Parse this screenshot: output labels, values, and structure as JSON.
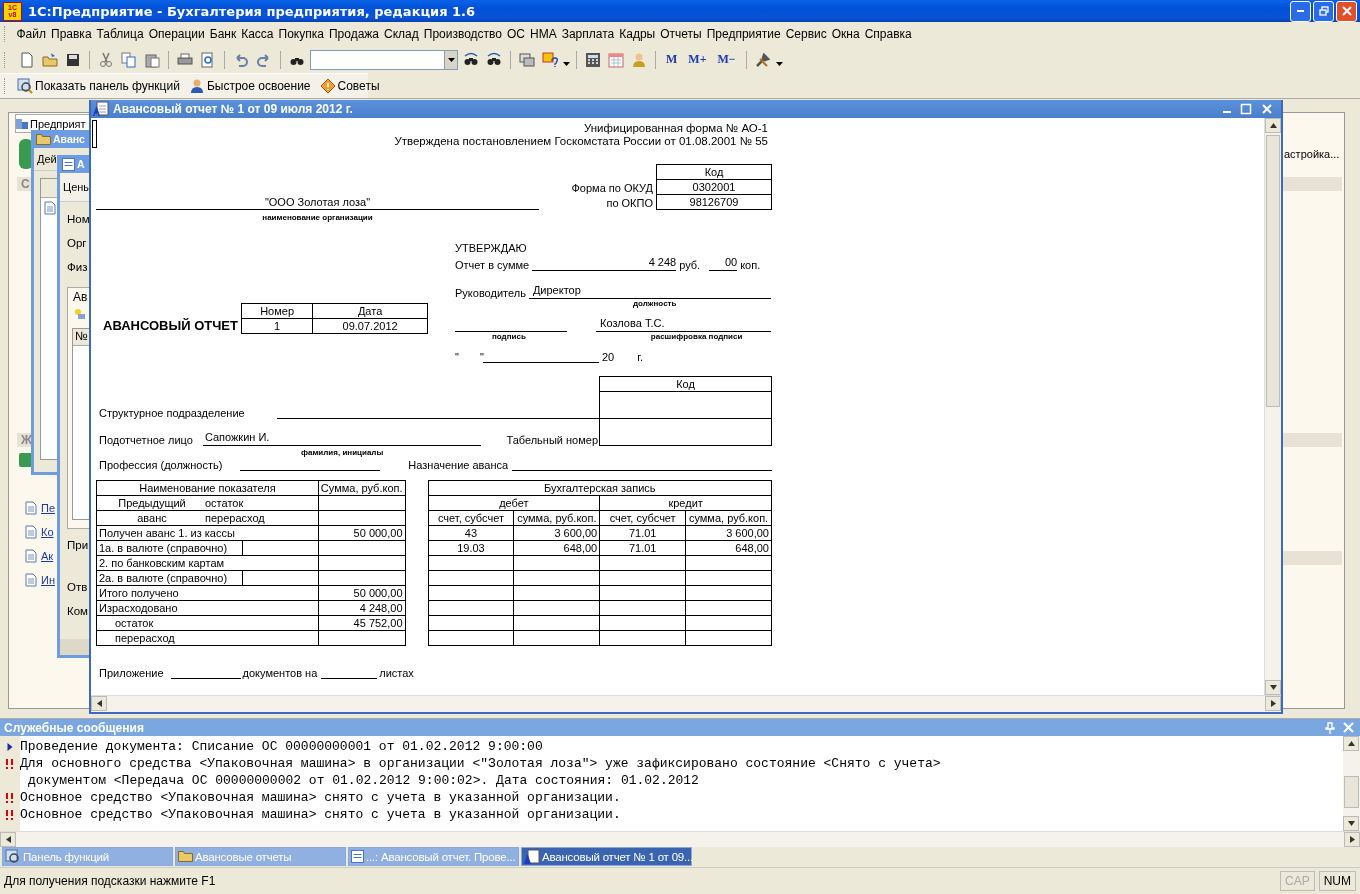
{
  "window": {
    "logo_top": "1С",
    "logo_bottom": "v8",
    "title": "1С:Предприятие - Бухгалтерия предприятия, редакция 1.6"
  },
  "menu": [
    "Файл",
    "Правка",
    "Таблица",
    "Операции",
    "Банк",
    "Касса",
    "Покупка",
    "Продажа",
    "Склад",
    "Производство",
    "ОС",
    "НМА",
    "Зарплата",
    "Кадры",
    "Отчеты",
    "Предприятие",
    "Сервис",
    "Окна",
    "Справка"
  ],
  "toolbar": {
    "memory_buttons": [
      "M",
      "M+",
      "M−"
    ]
  },
  "panel_toolbar": [
    "Показать панель функций",
    "Быстрое освоение",
    "Советы"
  ],
  "background": {
    "panel": {
      "tab": "Предприят",
      "sections": [
        "С",
        "Ж"
      ],
      "links": [
        "Пе",
        "Ко",
        "Ак",
        "Ин"
      ],
      "settings_link": "астройка..."
    },
    "list_window": {
      "title": "Аванс",
      "toolbar": "Дей"
    },
    "doc_window": {
      "title": "А",
      "tab": "Цены",
      "fields": [
        "Ном",
        "Орг",
        "Физ"
      ],
      "group": "Ав",
      "column": "№",
      "labels": [
        "При",
        "Отв",
        "Ком"
      ]
    }
  },
  "document": {
    "title": "Авансовый отчет № 1 от 09 июля 2012 г.",
    "header": [
      "Унифицированная форма № АО-1",
      "Утверждена постановлением Госкомстата России от  01.08.2001 № 55"
    ],
    "codes": {
      "heading": "Код",
      "rows": [
        {
          "label": "Форма по ОКУД",
          "value": "0302001"
        },
        {
          "label": "по ОКПО",
          "value": "98126709"
        }
      ]
    },
    "organization": {
      "value": "\"ООО Золотая лоза\"",
      "caption": "наименование организации"
    },
    "report_title": "АВАНСОВЫЙ ОТЧЕТ",
    "number_table": {
      "columns": [
        "Номер",
        "Дата"
      ],
      "values": [
        "1",
        "09.07.2012"
      ]
    },
    "approval": {
      "heading": "УТВЕРЖДАЮ",
      "sum_label": "Отчет в сумме",
      "sum": "4 248",
      "rub": "руб.",
      "kop": "00",
      "kop_label": "коп.",
      "head_label": "Руководитель",
      "head_value": "Директор",
      "head_caption": "должность",
      "signature_caption": "подпись",
      "name": "Козлова Т.С.",
      "name_caption": "расшифровка подписи",
      "quote_open": "\"",
      "quote_close": "\"",
      "year": "20",
      "year_suffix": "г."
    },
    "code_box": {
      "heading": "Код"
    },
    "subdivision_label": "Структурное подразделение",
    "person": {
      "label": "Подотчетное лицо",
      "value": "Сапожкин И.",
      "caption": "фамилия, инициалы",
      "tab_label": "Табельный номер"
    },
    "profession_label": "Профессия (должность)",
    "purpose_label": "Назначение аванса",
    "indicators": {
      "columns": [
        "Наименование показателя",
        "Сумма, руб.коп."
      ],
      "rows": [
        {
          "kind": "split",
          "label": "Предыдущий",
          "sublabel": "остаток"
        },
        {
          "kind": "split",
          "label": "аванс",
          "sublabel": "перерасход"
        },
        {
          "kind": "plain",
          "label": "Получен аванс 1. из кассы",
          "amount": "50 000,00",
          "entry": [
            "43",
            "3 600,00",
            "71.01",
            "3 600,00"
          ]
        },
        {
          "kind": "boxed",
          "label": "1а. в валюте (справочно)",
          "entry": [
            "19.03",
            "648,00",
            "71.01",
            "648,00"
          ]
        },
        {
          "kind": "plain",
          "label": "2. по банковским картам"
        },
        {
          "kind": "boxed",
          "label": "2а. в валюте (справочно)"
        },
        {
          "kind": "plain",
          "label": "Итого получено",
          "amount": "50 000,00"
        },
        {
          "kind": "plain",
          "label": "Израсходовано",
          "amount": "4 248,00"
        },
        {
          "kind": "indented",
          "label": "остаток",
          "amount": "45 752,00"
        },
        {
          "kind": "indented",
          "label": "перерасход"
        }
      ]
    },
    "entries": {
      "heading": "Бухгалтерская запись",
      "groups": [
        "дебет",
        "кредит"
      ],
      "columns": [
        "счет, субсчет",
        "сумма, руб.коп.",
        "счет, субсчет",
        "сумма, руб.коп."
      ]
    },
    "footer": {
      "label": "Приложение",
      "middle": "документов на",
      "end": "листах"
    }
  },
  "messages": {
    "title": "Служебные сообщения",
    "lines": [
      {
        "kind": "info",
        "text": "Проведение документа: Списание ОС 00000000001 от 01.02.2012 9:00:00"
      },
      {
        "kind": "error",
        "text": "Для основного средства <Упаковочная машина> в организации <\"Золотая лоза\"> уже зафиксировано состояние <Снято с учета>",
        "continuation": "документом <Передача ОС 00000000002 от 01.02.2012 9:00:02>. Дата состояния: 01.02.2012"
      },
      {
        "kind": "error",
        "text": "Основное средство <Упаковочная машина> снято с учета в указанной организации."
      },
      {
        "kind": "error",
        "text": "Основное средство <Упаковочная машина> снято с учета в указанной организации."
      }
    ]
  },
  "taskbar": [
    {
      "label": "Панель функций",
      "selected": false
    },
    {
      "label": "Авансовые отчеты",
      "selected": false
    },
    {
      "label": "...: Авансовый отчет. Прове...",
      "selected": false
    },
    {
      "label": "Авансовый отчет № 1 от 09...",
      "selected": true
    }
  ],
  "status_bar": {
    "hint": "Для получения подсказки нажмите F1",
    "indicators": [
      {
        "label": "CAP",
        "on": false
      },
      {
        "label": "NUM",
        "on": true
      }
    ]
  }
}
